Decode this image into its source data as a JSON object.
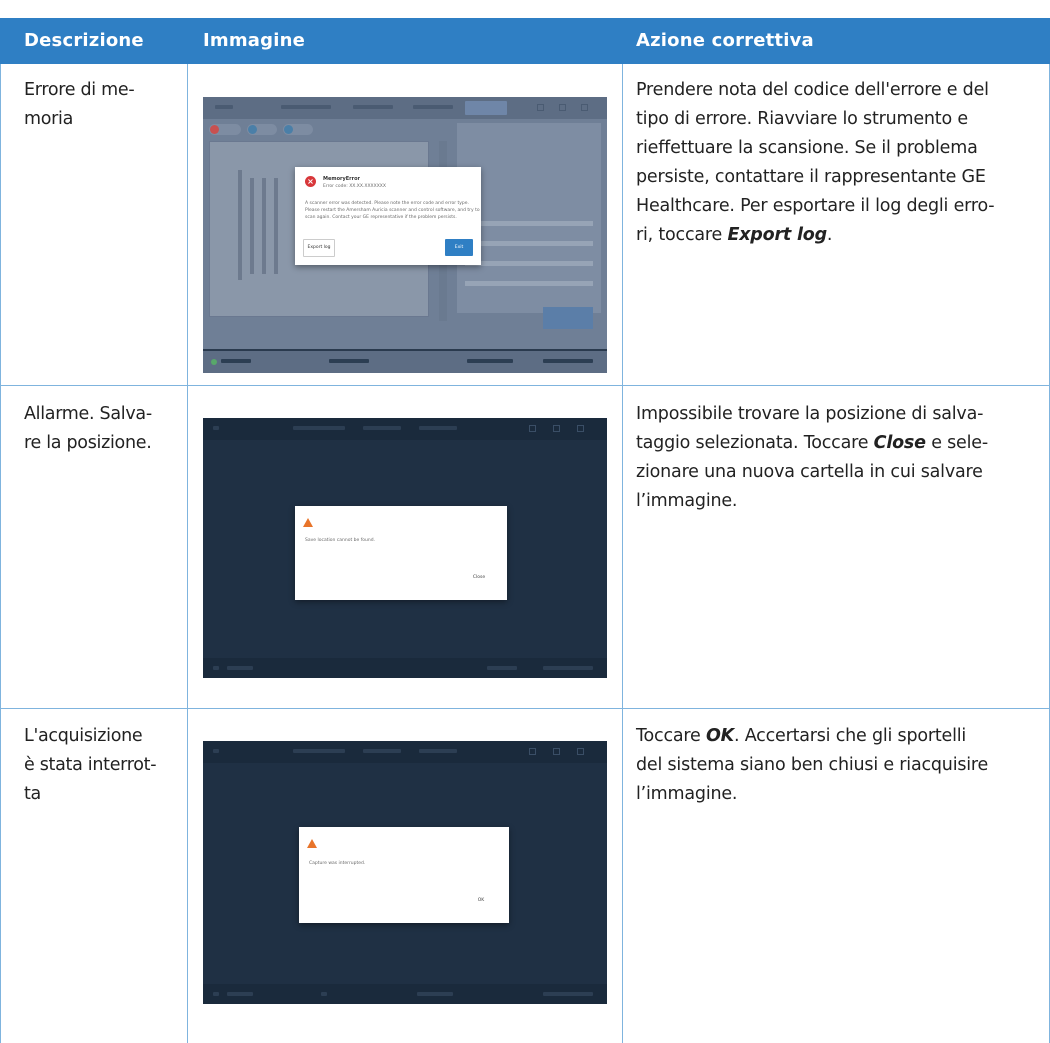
{
  "columns": {
    "descrizione": "Descrizione",
    "immagine": "Immagine",
    "azione": "Azione correttiva"
  },
  "rows": [
    {
      "desc_lines": [
        "Errore di me-",
        "moria"
      ],
      "action_lines": [
        "Prendere nota del codice dell'errore e del",
        "tipo di errore. Riavviare lo strumento e",
        "rieffettuare la scansione. Se il problema",
        "persiste, contattare il rappresentante GE",
        "Healthcare. Per esportare il log degli erro-"
      ],
      "action_last_pre": "ri, toccare ",
      "action_last_bold": "Export log",
      "action_last_post": ".",
      "shot": {
        "title": "MemoryError",
        "code": "Error code: XX.XX.XXXXXXX",
        "body": [
          "A scanner error was detected. Please note the error code and error type.",
          "Please restart the Amersham Auricia scanner and control software, and try to",
          "scan again. Contact your GE representative if the problem persists."
        ],
        "left_button": "Export log",
        "right_button": "Exit"
      }
    },
    {
      "desc_lines": [
        "Allarme. Salva-",
        "re la posizione."
      ],
      "action_pre": "Impossibile trovare la posizione di salva- taggio selezionata. Toccare ",
      "action_lines": [
        "Impossibile trovare la posizione di salva-",
        "taggio selezionata. Toccare "
      ],
      "action_bold": "Close",
      "action_l2_post": " e sele-",
      "action_more": [
        "zionare una nuova cartella in cui salvare",
        "l’immagine."
      ],
      "shot": {
        "message": "Save location cannot be found.",
        "button": "Close"
      }
    },
    {
      "desc_lines": [
        "L'acquisizione",
        "è stata interrot-",
        "ta"
      ],
      "action_pre": "Toccare ",
      "action_bold": "OK",
      "action_l1_post": ". Accertarsi che gli sportelli",
      "action_more": [
        "del sistema siano ben chiusi e riacquisire",
        "l’immagine."
      ],
      "shot": {
        "message": "Capture was interrupted.",
        "button": "OK"
      }
    }
  ],
  "colors": {
    "header_bg": "#2f7fc4",
    "rule": "#7fb4de",
    "app_bg": "#1f3044",
    "warning": "#e8742a",
    "error": "#d8373a",
    "primary_button": "#2f7fc4"
  }
}
